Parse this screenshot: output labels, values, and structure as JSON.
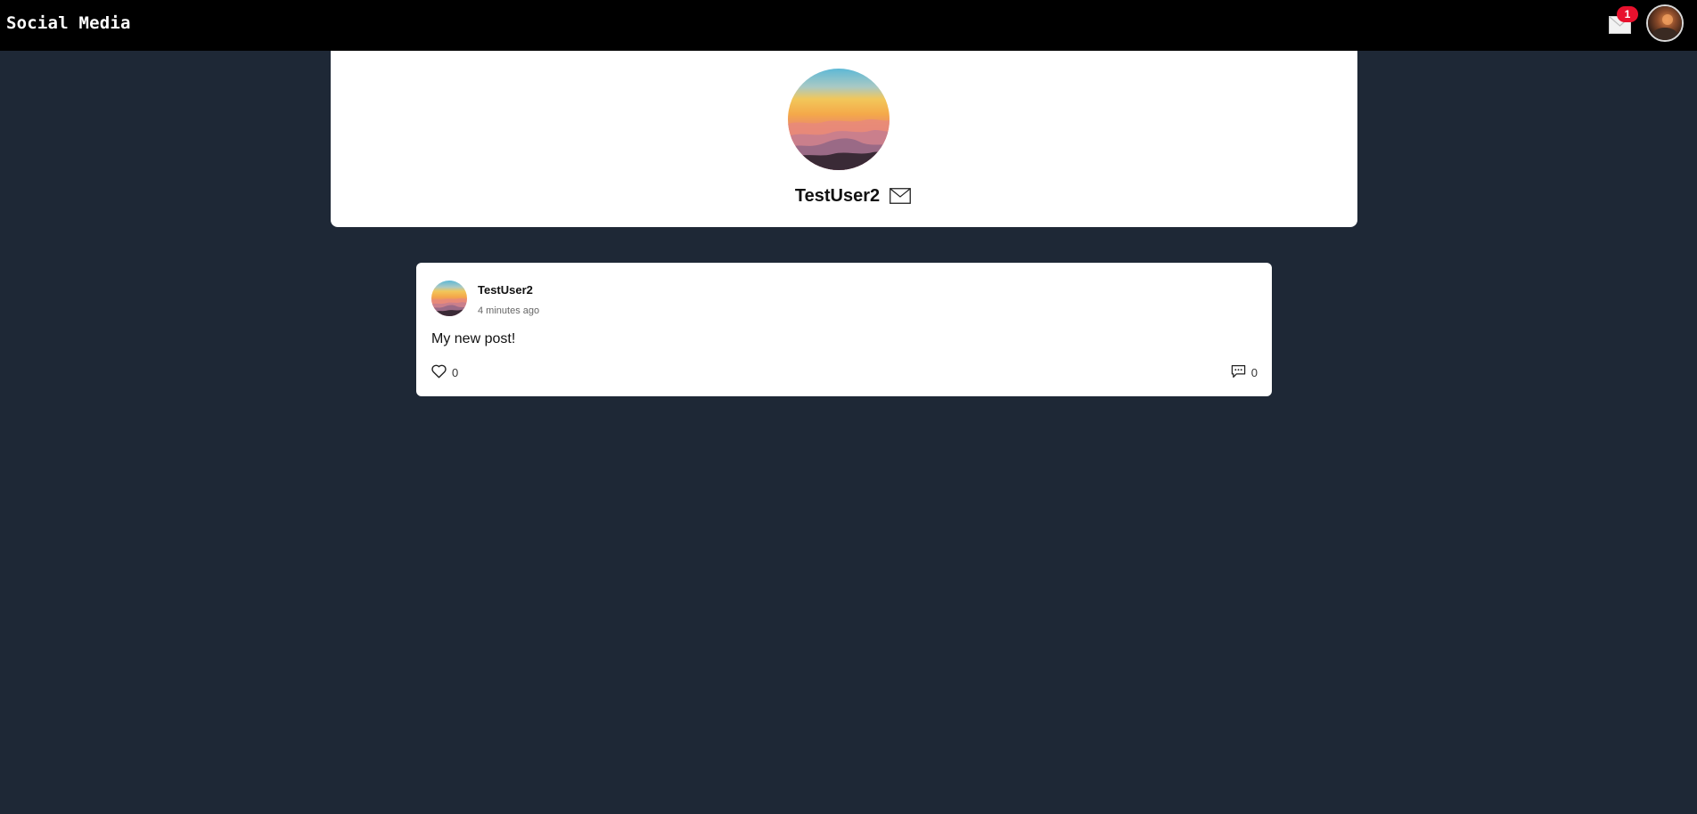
{
  "navbar": {
    "brand": "Social Media",
    "notification_count": "1",
    "mail_icon": "envelope-icon",
    "avatar_icon": "user-avatar"
  },
  "profile": {
    "username": "TestUser2",
    "message_icon": "envelope-icon"
  },
  "post": {
    "author": "TestUser2",
    "time": "4 minutes ago",
    "content": "My new post!",
    "likes": "0",
    "comments": "0",
    "like_icon": "heart-icon",
    "comment_icon": "comment-icon"
  },
  "colors": {
    "page_background": "#1e2836",
    "navbar_background": "#000000",
    "card_background": "#ffffff",
    "badge": "#e8112d"
  }
}
